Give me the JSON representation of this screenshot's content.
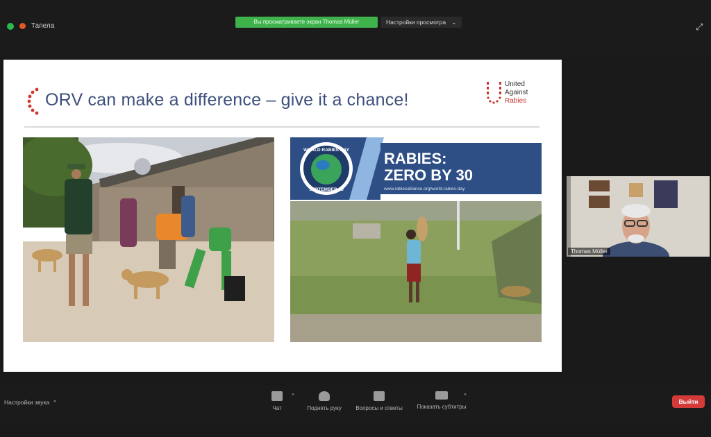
{
  "topbar": {
    "user_label": "Тапела",
    "share_banner": "Вы просматриваете экран Thomas Müller",
    "view_options": "Настройки просмотра",
    "view_options_caret": "⌄",
    "expand_symbol": "⤢"
  },
  "slide": {
    "title": "ORV can make a difference – give it a chance!",
    "logo": {
      "line1": "United",
      "line2": "Against",
      "line3": "Rabies"
    },
    "banner": {
      "badge_top": "WORLD RABIES DAY",
      "badge_bottom": "SEPTEMBER 28",
      "headline1": "RABIES:",
      "headline2": "ZERO BY 30",
      "url": "www.rabiesalliance.org/world-rabies-day"
    }
  },
  "video": {
    "participant_name": "Thomas Müller"
  },
  "bottombar": {
    "audio_settings": "Настройки звука",
    "audio_caret": "^",
    "controls": [
      {
        "label": "Чат"
      },
      {
        "label": "Поднять руку"
      },
      {
        "label": "Вопросы и ответы"
      },
      {
        "label": "Показать субтитры"
      }
    ],
    "caret": "^",
    "leave": "Выйти"
  },
  "colors": {
    "background": "#1a1a1a",
    "share_banner": "#3fb24c",
    "leave_button": "#d43a3a",
    "slide_title": "#3d4f7c",
    "banner_blue": "#2e4f86",
    "accent_red": "#c9342e"
  },
  "icons": {
    "shield": "shield-icon",
    "record": "record-dot-icon",
    "expand": "expand-icon",
    "chat": "chat-icon",
    "hand": "raise-hand-icon",
    "qa": "qa-icon",
    "cc": "captions-icon"
  }
}
